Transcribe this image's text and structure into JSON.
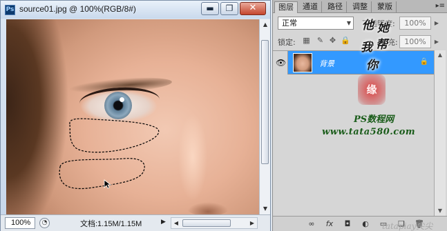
{
  "document": {
    "app_icon": "Ps",
    "title": "source01.jpg @ 100%(RGB/8#)",
    "window_buttons": [
      {
        "name": "minimize-button",
        "icon": "minimize-icon",
        "glyph": "▬"
      },
      {
        "name": "restore-button",
        "icon": "restore-icon",
        "glyph": "❐"
      },
      {
        "name": "close-button",
        "icon": "close-icon",
        "glyph": "✕"
      }
    ],
    "status": {
      "zoom": "100%",
      "doc_info": "文档:1.15M/1.15M",
      "more_arrow": "▶"
    }
  },
  "panel": {
    "tabs": [
      "图层",
      "通道",
      "路径",
      "调整",
      "蒙版"
    ],
    "active_tab": 0,
    "menu_glyph": "▸≡",
    "blend_mode": "正常",
    "opacity_label": "不透明度:",
    "opacity_value": "100%",
    "lock_label": "锁定:",
    "fill_label": "填充:",
    "fill_value": "100%",
    "layers": [
      {
        "name": "背景",
        "visible": true,
        "locked": true,
        "selected": true
      }
    ],
    "footer_icons": [
      "link-icon",
      "fx-icon",
      "mask-icon",
      "adjustment-icon",
      "group-icon",
      "new-layer-icon",
      "trash-icon"
    ]
  },
  "watermark": {
    "vertical_chars": [
      "他",
      "她",
      "帮",
      "我",
      "你"
    ],
    "seal_text": "缘",
    "line1": "PS数程网",
    "line2": "www.tata580.com",
    "corner": "tatapiay尖尖"
  },
  "colors": {
    "selection_highlight": "#3399ff",
    "close_button": "#c4452d",
    "seal_red": "#d22828"
  }
}
